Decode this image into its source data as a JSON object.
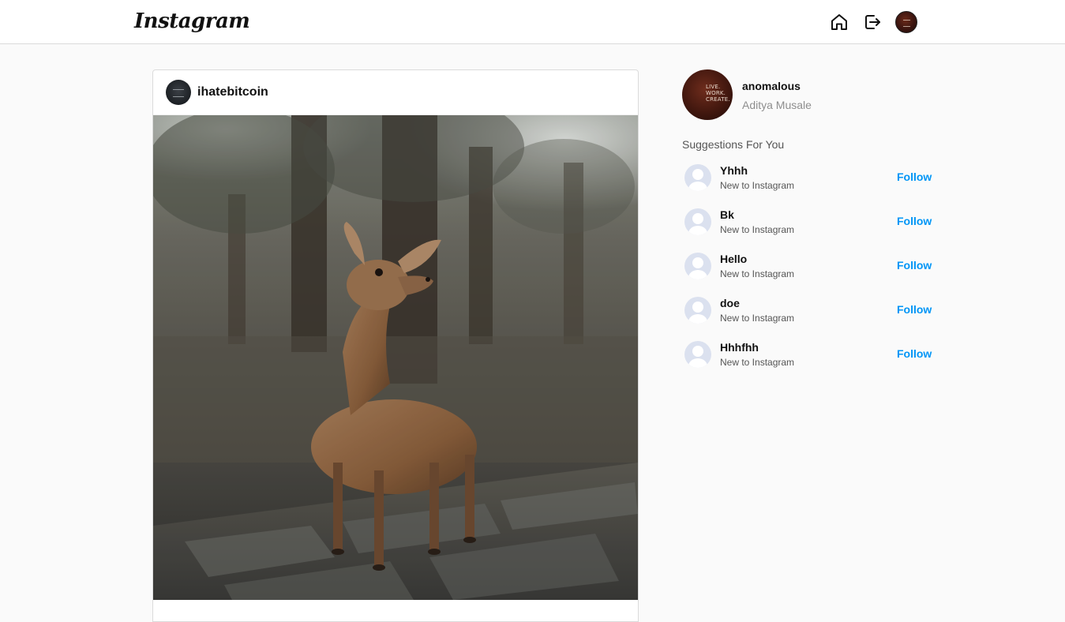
{
  "brand": {
    "logo_text": "Instagram"
  },
  "nav": {
    "home_icon": "home-icon",
    "logout_icon": "logout-icon",
    "avatar_icon": "profile-avatar-icon"
  },
  "post": {
    "username": "ihatebitcoin",
    "image_subject": "deer-photo"
  },
  "profile": {
    "username": "anomalous",
    "full_name": "Aditya Musale",
    "avatar_text": "LIVE. WORK. CREATE."
  },
  "suggestions": {
    "title": "Suggestions For You",
    "items": [
      {
        "name": "Yhhh",
        "subtitle": "New to Instagram",
        "action": "Follow"
      },
      {
        "name": "Bk",
        "subtitle": "New to Instagram",
        "action": "Follow"
      },
      {
        "name": "Hello",
        "subtitle": "New to Instagram",
        "action": "Follow"
      },
      {
        "name": "doe",
        "subtitle": "New to Instagram",
        "action": "Follow"
      },
      {
        "name": "Hhhfhh",
        "subtitle": "New to Instagram",
        "action": "Follow"
      }
    ]
  },
  "colors": {
    "accent": "#0095f6",
    "background": "#fafafa",
    "border": "#dbdbdb"
  }
}
